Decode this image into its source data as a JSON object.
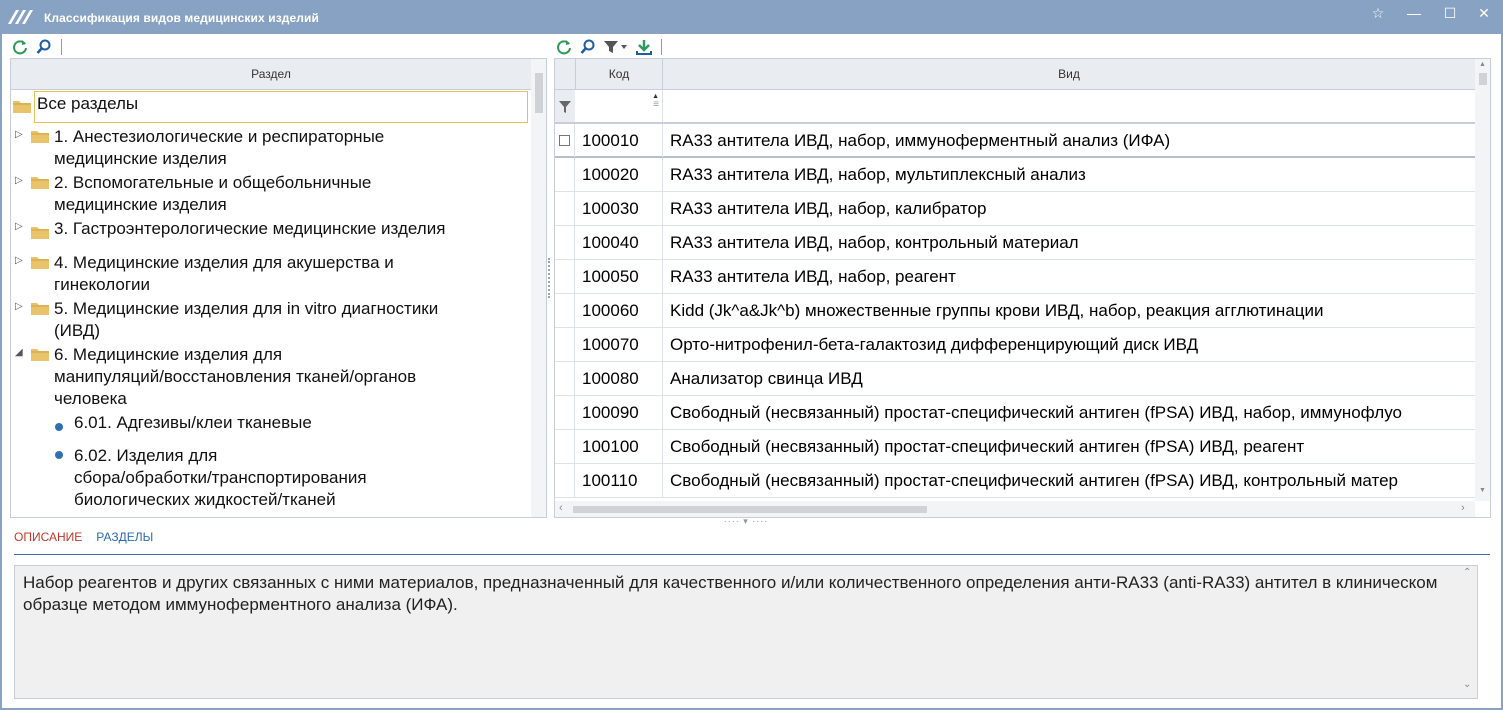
{
  "window": {
    "title": "Классификация видов медицинских изделий",
    "logo_icon": "app-logo-icon",
    "controls": {
      "favorite": "☆",
      "minimize": "—",
      "maximize": "☐",
      "close": "✕"
    }
  },
  "left_panel": {
    "header": "Раздел",
    "tree": [
      {
        "label": "Все разделы",
        "level": 0,
        "type": "folder",
        "selected": true
      },
      {
        "label": "1. Анестезиологические и респираторные",
        "label2": "медицинские изделия",
        "level": 1,
        "type": "folder",
        "expander": "▷"
      },
      {
        "label": "2. Вспомогательные и общебольничные",
        "label2": "медицинские изделия",
        "level": 1,
        "type": "folder",
        "expander": "▷"
      },
      {
        "label": "3. Гастроэнтерологические медицинские изделия",
        "level": 1,
        "type": "folder",
        "expander": "▷"
      },
      {
        "label": "4. Медицинские изделия для акушерства и",
        "label2": "гинекологии",
        "level": 1,
        "type": "folder",
        "expander": "▷"
      },
      {
        "label": "5. Медицинские изделия для in vitro диагностики",
        "label2": "(ИВД)",
        "level": 1,
        "type": "folder",
        "expander": "▷"
      },
      {
        "label": "6. Медицинские изделия для",
        "label2": "манипуляций/восстановления тканей/органов",
        "label3": "человека",
        "level": 1,
        "type": "folder",
        "expander": "◢"
      },
      {
        "label": "6.01. Адгезивы/клеи тканевые",
        "level": 2,
        "type": "leaf"
      },
      {
        "label": "6.02. Изделия для",
        "label2": "сбора/обработки/транспортирования",
        "label3": "биологических жидкостей/тканей",
        "level": 2,
        "type": "leaf"
      }
    ]
  },
  "right_panel": {
    "columns": {
      "code": "Код",
      "name": "Вид"
    },
    "rows": [
      {
        "code": "100010",
        "name": "RA33 антитела ИВД, набор, иммуноферментный анализ (ИФА)"
      },
      {
        "code": "100020",
        "name": "RA33 антитела ИВД, набор, мультиплексный анализ"
      },
      {
        "code": "100030",
        "name": "RA33 антитела ИВД, набор, калибратор"
      },
      {
        "code": "100040",
        "name": "RA33 антитела ИВД, набор, контрольный материал"
      },
      {
        "code": "100050",
        "name": "RA33 антитела ИВД, набор, реагент"
      },
      {
        "code": "100060",
        "name": "Kidd (Jk^a&Jk^b) множественные группы крови ИВД, набор, реакция агглютинации"
      },
      {
        "code": "100070",
        "name": "Орто-нитрофенил-бета-галактозид дифференцирующий диск ИВД"
      },
      {
        "code": "100080",
        "name": "Анализатор свинца ИВД"
      },
      {
        "code": "100090",
        "name": "Свободный (несвязанный) простат-специфический антиген (fPSA) ИВД, набор, иммунофлуо"
      },
      {
        "code": "100100",
        "name": "Свободный (несвязанный) простат-специфический антиген (fPSA) ИВД, реагент"
      },
      {
        "code": "100110",
        "name": "Свободный (несвязанный) простат-специфический антиген (fPSA) ИВД, контрольный матер"
      }
    ]
  },
  "bottom": {
    "tabs": [
      {
        "label": "ОПИСАНИЕ",
        "active": true
      },
      {
        "label": "РАЗДЕЛЫ",
        "active": false
      }
    ],
    "description": "Набор реагентов и других связанных с ними материалов, предназначенный для качественного и/или количественного определения анти-RA33 (anti-RA33) антител в клиническом образце методом иммуноферментного анализа (ИФА)."
  },
  "colors": {
    "titlebar": "#87a2c2",
    "folder": "#e8c36a",
    "accent_green": "#2e9a5a",
    "accent_blue": "#2b6bb0",
    "active_tab": "#c0392b"
  }
}
